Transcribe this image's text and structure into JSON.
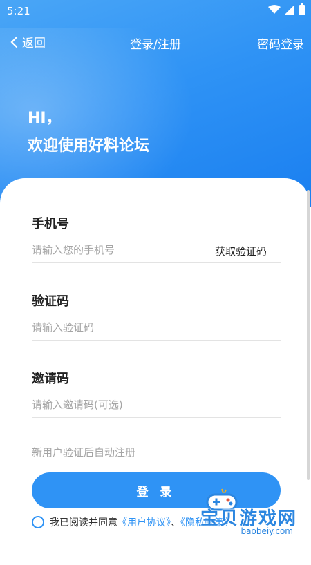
{
  "status": {
    "time": "5:21"
  },
  "nav": {
    "back_label": "返回",
    "title": "登录/注册",
    "right_label": "密码登录"
  },
  "greeting": {
    "line1": "HI，",
    "line2": "欢迎使用好料论坛"
  },
  "form": {
    "phone": {
      "label": "手机号",
      "placeholder": "请输入您的手机号",
      "action": "获取验证码"
    },
    "code": {
      "label": "验证码",
      "placeholder": "请输入验证码"
    },
    "invite": {
      "label": "邀请码",
      "placeholder": "请输入邀请码(可选)"
    },
    "note": "新用户验证后自动注册",
    "login_label": "登 录"
  },
  "agreement": {
    "prefix": "我已阅读并同意",
    "user_link": "《用户协议》",
    "separator": "、",
    "privacy_link": "《隐私政策》"
  },
  "watermark": {
    "text": "宝贝游戏网",
    "url": "baobeiy.com"
  },
  "colors": {
    "accent": "#2f93f5",
    "gradient_start": "#4aa6f6",
    "gradient_end": "#1a7ff0"
  }
}
